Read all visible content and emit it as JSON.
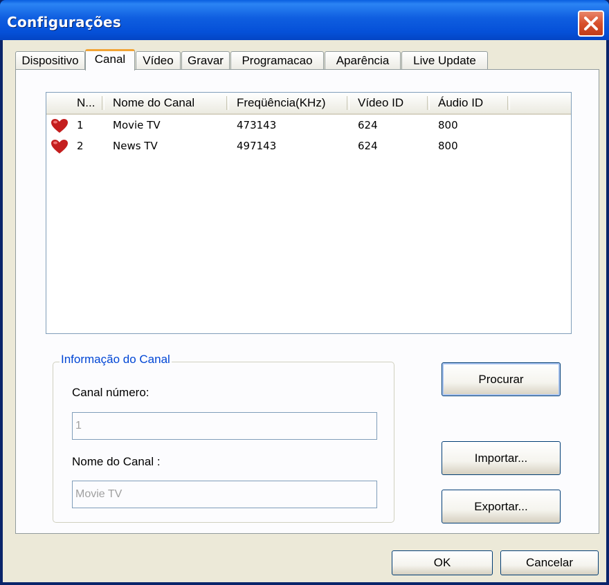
{
  "window": {
    "title": "Configurações"
  },
  "tabs": [
    {
      "label": "Dispositivo"
    },
    {
      "label": "Canal"
    },
    {
      "label": "Vídeo"
    },
    {
      "label": "Gravar"
    },
    {
      "label": "Programacao"
    },
    {
      "label": "Aparência"
    },
    {
      "label": "Live Update"
    }
  ],
  "channel_list": {
    "columns": [
      "N...",
      "Nome do Canal",
      "Freqüência(KHz)",
      "Vídeo ID",
      "Áudio ID"
    ],
    "rows": [
      {
        "n": "1",
        "name": "Movie TV",
        "freq": "473143",
        "video_id": "624",
        "audio_id": "800",
        "icon": "heart-icon"
      },
      {
        "n": "2",
        "name": "News TV",
        "freq": "497143",
        "video_id": "624",
        "audio_id": "800",
        "icon": "heart-icon"
      }
    ]
  },
  "channel_info": {
    "legend": "Informação do Canal",
    "number_label": "Canal número:",
    "number_value": "1",
    "name_label": "Nome do Canal :",
    "name_value": "Movie TV"
  },
  "buttons": {
    "search": "Procurar",
    "import": "Importar...",
    "export": "Exportar...",
    "ok": "OK",
    "cancel": "Cancelar"
  },
  "colors": {
    "accent": "#0046d5",
    "heart": "#c41e1e",
    "close": "#d8502c"
  }
}
